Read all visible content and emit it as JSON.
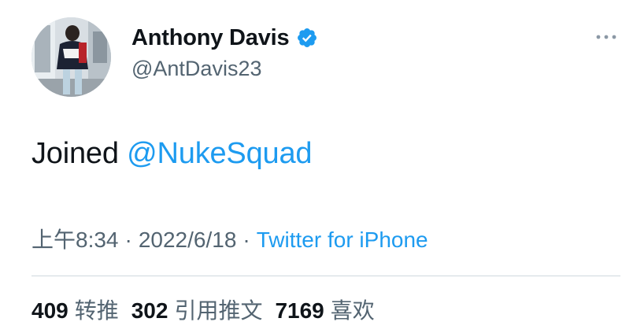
{
  "author": {
    "display_name": "Anthony Davis",
    "handle": "@AntDavis23",
    "verified_icon": "verified-badge-icon",
    "avatar_icon": "profile-photo"
  },
  "tweet": {
    "text_prefix": "Joined ",
    "mention": "@NukeSquad"
  },
  "meta": {
    "time": "上午8:34",
    "separator": "·",
    "date": "2022/6/18",
    "source": "Twitter for iPhone"
  },
  "stats": {
    "retweets_count": "409",
    "retweets_label": "转推",
    "quotes_count": "302",
    "quotes_label": "引用推文",
    "likes_count": "7169",
    "likes_label": "喜欢"
  },
  "colors": {
    "accent": "#1d9bf0",
    "text": "#0f1419",
    "secondary": "#536471",
    "divider": "#cfd9de"
  }
}
